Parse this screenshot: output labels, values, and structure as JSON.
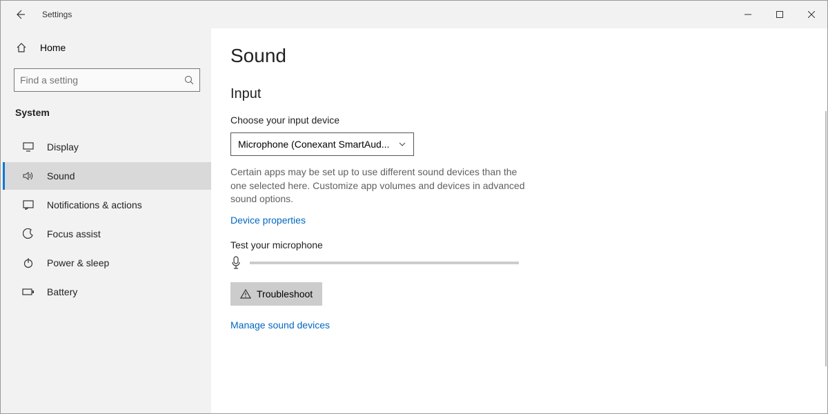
{
  "window": {
    "title": "Settings"
  },
  "sidebar": {
    "home_label": "Home",
    "search_placeholder": "Find a setting",
    "category": "System",
    "items": [
      {
        "label": "Display",
        "icon": "display"
      },
      {
        "label": "Sound",
        "icon": "sound",
        "active": true
      },
      {
        "label": "Notifications & actions",
        "icon": "notifications"
      },
      {
        "label": "Focus assist",
        "icon": "focus"
      },
      {
        "label": "Power & sleep",
        "icon": "power"
      },
      {
        "label": "Battery",
        "icon": "battery"
      }
    ]
  },
  "main": {
    "page_title": "Sound",
    "section_title": "Input",
    "choose_label": "Choose your input device",
    "device_selected": "Microphone (Conexant SmartAud...",
    "description": "Certain apps may be set up to use different sound devices than the one selected here. Customize app volumes and devices in advanced sound options.",
    "link_device_properties": "Device properties",
    "test_label": "Test your microphone",
    "troubleshoot_label": "Troubleshoot",
    "link_manage": "Manage sound devices"
  }
}
